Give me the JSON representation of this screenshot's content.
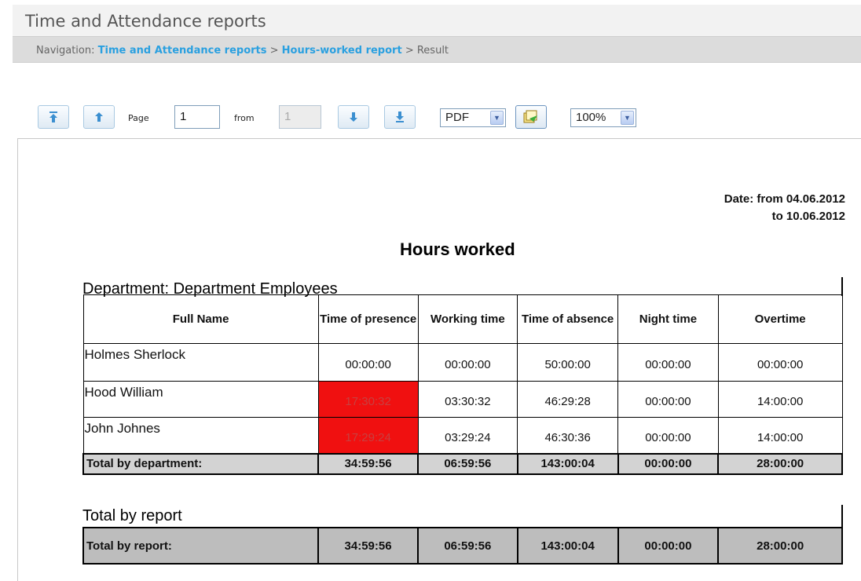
{
  "app": {
    "title": "Time and Attendance reports"
  },
  "nav": {
    "prefix": "Navigation:",
    "crumb1": "Time and Attendance reports",
    "sep": ">",
    "crumb2": "Hours-worked report",
    "crumb3": "Result"
  },
  "toolbar": {
    "page_label": "Page",
    "page_value": "1",
    "from_label": "from",
    "from_value": "1",
    "format_value": "PDF",
    "zoom_value": "100%"
  },
  "report": {
    "date_line1": "Date: from 04.06.2012",
    "date_line2": "to 10.06.2012",
    "title": "Hours worked",
    "department_title": "Department: Department Employees",
    "columns": [
      "Full Name",
      "Time of presence",
      "Working time",
      "Time of absence",
      "Night time",
      "Overtime"
    ],
    "rows": [
      {
        "name": "Holmes Sherlock",
        "presence": "00:00:00",
        "working": "00:00:00",
        "absence": "50:00:00",
        "night": "00:00:00",
        "overtime": "00:00:00"
      },
      {
        "name": "Hood William",
        "presence": "17:30:32",
        "working": "03:30:32",
        "absence": "46:29:28",
        "night": "00:00:00",
        "overtime": "14:00:00"
      },
      {
        "name": "John Johnes",
        "presence": "17:29:24",
        "working": "03:29:24",
        "absence": "46:30:36",
        "night": "00:00:00",
        "overtime": "14:00:00"
      }
    ],
    "dept_total": {
      "label": "Total by department:",
      "presence": "34:59:56",
      "working": "06:59:56",
      "absence": "143:00:04",
      "night": "00:00:00",
      "overtime": "28:00:00"
    },
    "report_total_title": "Total by report",
    "report_total": {
      "label": "Total by report:",
      "presence": "34:59:56",
      "working": "06:59:56",
      "absence": "143:00:04",
      "night": "00:00:00",
      "overtime": "28:00:00"
    },
    "highlight_color": "#f01010"
  }
}
